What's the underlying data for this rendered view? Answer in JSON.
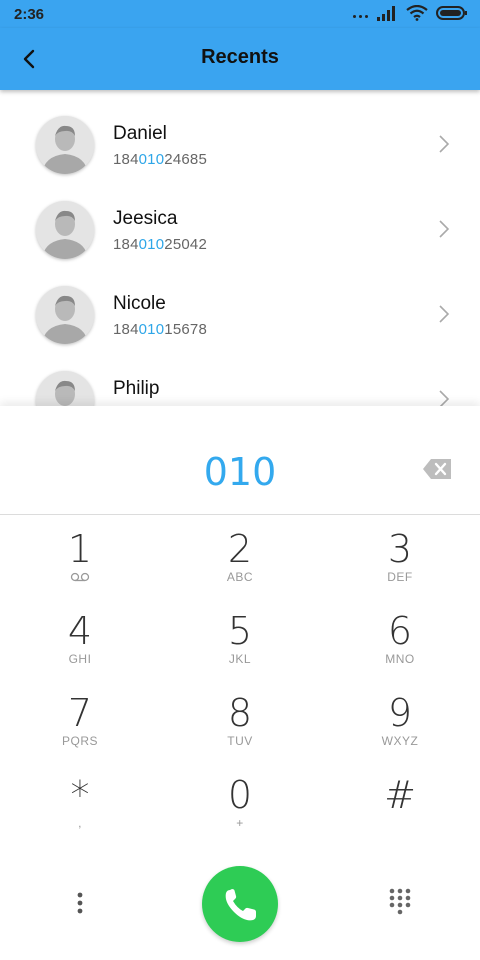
{
  "status": {
    "time": "2:36"
  },
  "header": {
    "title": "Recents"
  },
  "contacts": [
    {
      "name": "Daniel",
      "num_pre": "184",
      "num_hl": "010",
      "num_post": "24685"
    },
    {
      "name": "Jeesica",
      "num_pre": "184",
      "num_hl": "010",
      "num_post": "25042"
    },
    {
      "name": "Nicole",
      "num_pre": "184",
      "num_hl": "010",
      "num_post": "15678"
    },
    {
      "name": "Philip",
      "num_pre": "",
      "num_hl": "",
      "num_post": ""
    }
  ],
  "dialer": {
    "entered": "010",
    "keys": [
      {
        "digit": "1",
        "letters": ""
      },
      {
        "digit": "2",
        "letters": "ABC"
      },
      {
        "digit": "3",
        "letters": "DEF"
      },
      {
        "digit": "4",
        "letters": "GHI"
      },
      {
        "digit": "5",
        "letters": "JKL"
      },
      {
        "digit": "6",
        "letters": "MNO"
      },
      {
        "digit": "7",
        "letters": "PQRS"
      },
      {
        "digit": "8",
        "letters": "TUV"
      },
      {
        "digit": "9",
        "letters": "WXYZ"
      },
      {
        "digit": "*",
        "letters": ","
      },
      {
        "digit": "0",
        "letters": "+"
      },
      {
        "digit": "#",
        "letters": ""
      }
    ]
  },
  "colors": {
    "accent": "#3aa4f0",
    "highlight": "#2ea6e8",
    "call": "#2ecc55"
  }
}
